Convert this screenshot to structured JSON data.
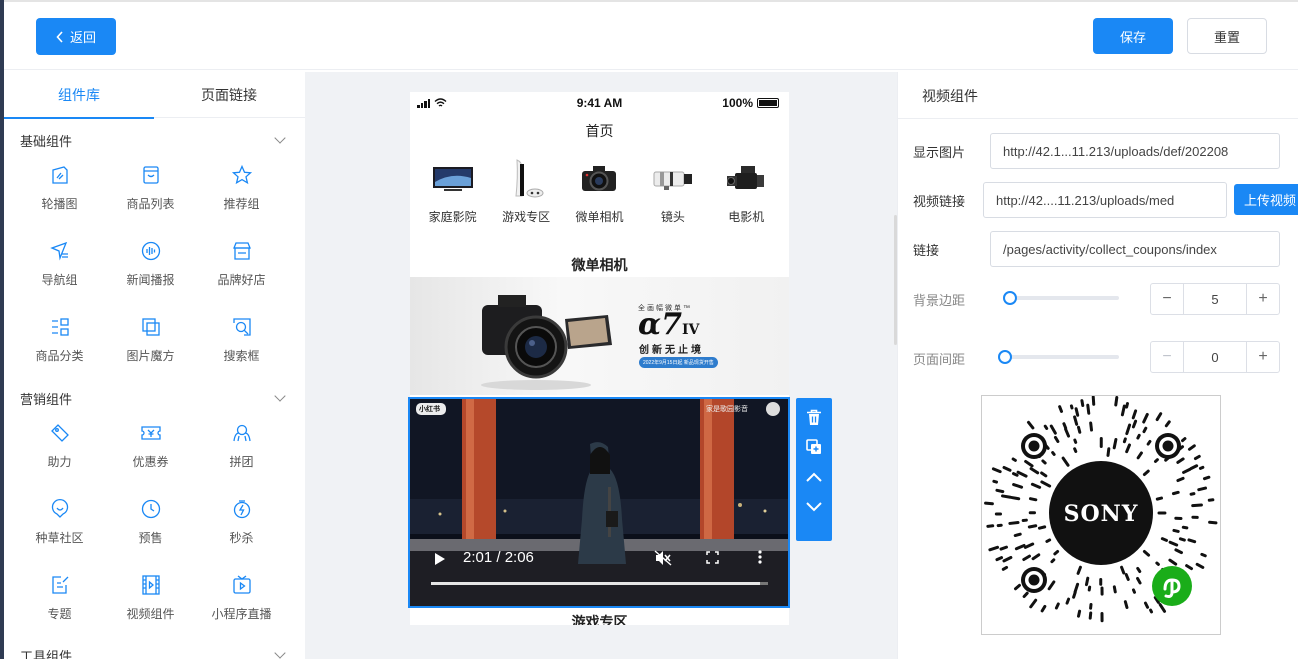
{
  "header": {
    "back_label": "返回",
    "save_label": "保存",
    "reset_label": "重置"
  },
  "left_tabs": [
    "组件库",
    "页面链接"
  ],
  "groups": [
    {
      "title": "基础组件",
      "items": [
        {
          "label": "轮播图",
          "icon": "carousel-icon"
        },
        {
          "label": "商品列表",
          "icon": "product-list-icon"
        },
        {
          "label": "推荐组",
          "icon": "star-icon"
        },
        {
          "label": "导航组",
          "icon": "navigation-icon"
        },
        {
          "label": "新闻播报",
          "icon": "broadcast-icon"
        },
        {
          "label": "品牌好店",
          "icon": "store-icon"
        },
        {
          "label": "商品分类",
          "icon": "category-icon"
        },
        {
          "label": "图片魔方",
          "icon": "image-cube-icon"
        },
        {
          "label": "搜索框",
          "icon": "search-box-icon"
        }
      ]
    },
    {
      "title": "营销组件",
      "items": [
        {
          "label": "助力",
          "icon": "tag-icon"
        },
        {
          "label": "优惠券",
          "icon": "coupon-icon"
        },
        {
          "label": "拼团",
          "icon": "group-buy-icon"
        },
        {
          "label": "种草社区",
          "icon": "community-icon"
        },
        {
          "label": "预售",
          "icon": "clock-icon"
        },
        {
          "label": "秒杀",
          "icon": "flash-sale-icon"
        },
        {
          "label": "专题",
          "icon": "topic-icon"
        },
        {
          "label": "视频组件",
          "icon": "video-icon"
        },
        {
          "label": "小程序直播",
          "icon": "live-icon"
        }
      ]
    },
    {
      "title": "工具组件"
    }
  ],
  "phone": {
    "time": "9:41 AM",
    "battery": "100%",
    "page_title": "首页",
    "categories": [
      "家庭影院",
      "游戏专区",
      "微单相机",
      "镜头",
      "电影机"
    ],
    "section_title": "微单相机",
    "banner": {
      "tagline": "全画幅微单™",
      "model": "α7",
      "model_suffix": "IV",
      "slogan": "创新无止境",
      "badge": "2022年9月15日起 新品现货开售"
    },
    "video": {
      "badge": "小红书",
      "channel": "家是歌园影音",
      "time": "2:01 / 2:06",
      "progress": 0.976
    },
    "next_section": "游戏专区"
  },
  "right": {
    "title": "视频组件",
    "fields": [
      {
        "label": "显示图片",
        "value": "http://42.1...11.213/uploads/def/202208"
      },
      {
        "label": "视频链接",
        "value": "http://42....11.213/uploads/med"
      },
      {
        "label": "链接",
        "value": "/pages/activity/collect_coupons/index"
      }
    ],
    "upload_label": "上传视频",
    "bg_margin": {
      "label": "背景边距",
      "value": "5"
    },
    "page_spacing": {
      "label": "页面间距",
      "value": "0"
    },
    "qr_text": "SONY"
  },
  "colors": {
    "accent": "#1a88f5",
    "canvas_bg": "#f0f2f5",
    "sidebar_edge": "#2f3b53"
  }
}
